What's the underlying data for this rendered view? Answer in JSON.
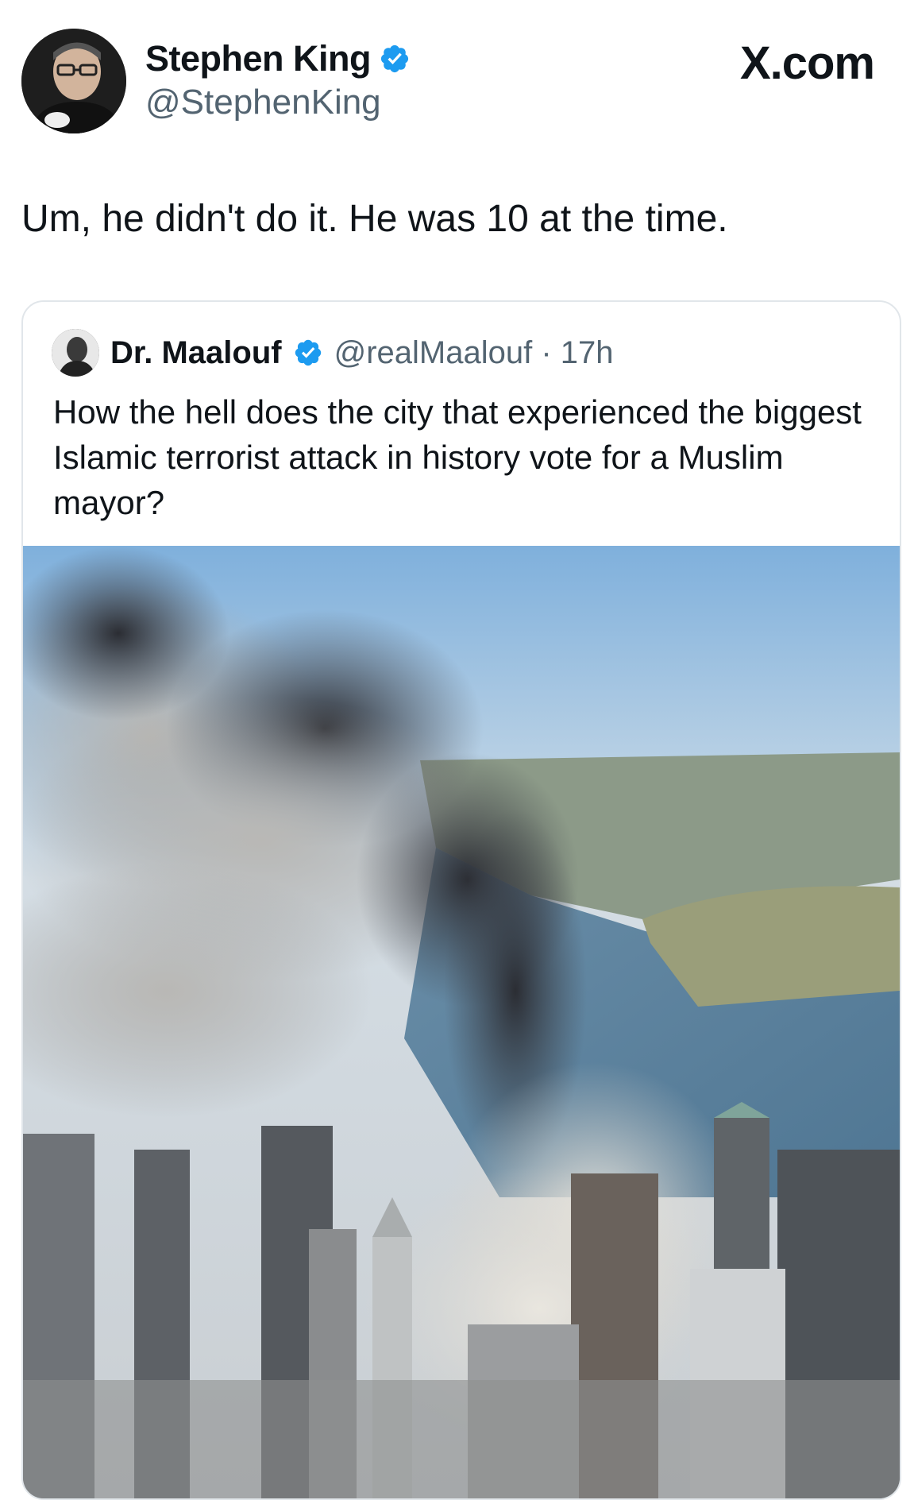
{
  "header": {
    "display_name": "Stephen King",
    "handle": "@StephenKing",
    "brand": "X.com",
    "verified_color": "#1d9bf0"
  },
  "tweet": {
    "text": "Um, he didn't do it. He was 10 at the time."
  },
  "quoted_tweet": {
    "display_name": "Dr. Maalouf",
    "handle_time": "@realMaalouf · 17h",
    "text": "How the hell does the city that experienced the biggest Islamic terrorist attack in history vote for a Muslim mayor?",
    "media": "aerial-photo"
  },
  "icons": {
    "verified": "verified-badge-icon"
  }
}
